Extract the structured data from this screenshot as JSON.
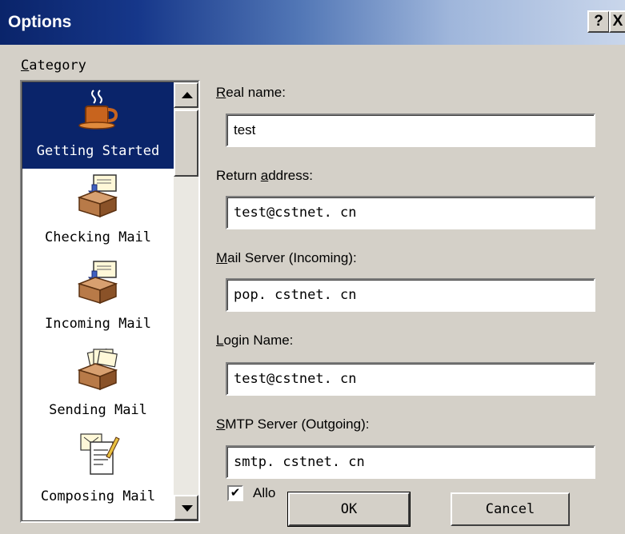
{
  "window": {
    "title": "Options",
    "help_label": "?",
    "close_label": "X"
  },
  "category": {
    "label_prefix": "C",
    "label_rest": "ategory",
    "items": [
      {
        "label": "Getting Started",
        "icon": "coffee-cup-icon",
        "selected": true
      },
      {
        "label": "Checking Mail",
        "icon": "mailbox-icon",
        "selected": false
      },
      {
        "label": "Incoming Mail",
        "icon": "mailbox-icon",
        "selected": false
      },
      {
        "label": "Sending Mail",
        "icon": "outbox-icon",
        "selected": false
      },
      {
        "label": "Composing Mail",
        "icon": "compose-document-icon",
        "selected": false
      }
    ]
  },
  "fields": {
    "real_name": {
      "label_u": "R",
      "label_rest": "eal name:",
      "value": "test"
    },
    "return_address": {
      "label_pre": "Return ",
      "label_u": "a",
      "label_rest": "ddress:",
      "value": "test@cstnet. cn"
    },
    "mail_server": {
      "label_u": "M",
      "label_rest": "ail Server (Incoming):",
      "value": "pop. cstnet. cn"
    },
    "login_name": {
      "label_u": "L",
      "label_rest": "ogin Name:",
      "value": "test@cstnet. cn"
    },
    "smtp_server": {
      "label_u": "S",
      "label_rest": "MTP Server (Outgoing):",
      "value": "smtp. cstnet. cn"
    }
  },
  "checkbox": {
    "mark": "✔",
    "label": "Allo",
    "checked": true
  },
  "buttons": {
    "ok": "OK",
    "cancel": "Cancel"
  },
  "colors": {
    "title_bar_start": "#0a246a",
    "title_bar_end": "#c9d6eb",
    "selection": "#0a246a",
    "face": "#d4d0c8"
  }
}
